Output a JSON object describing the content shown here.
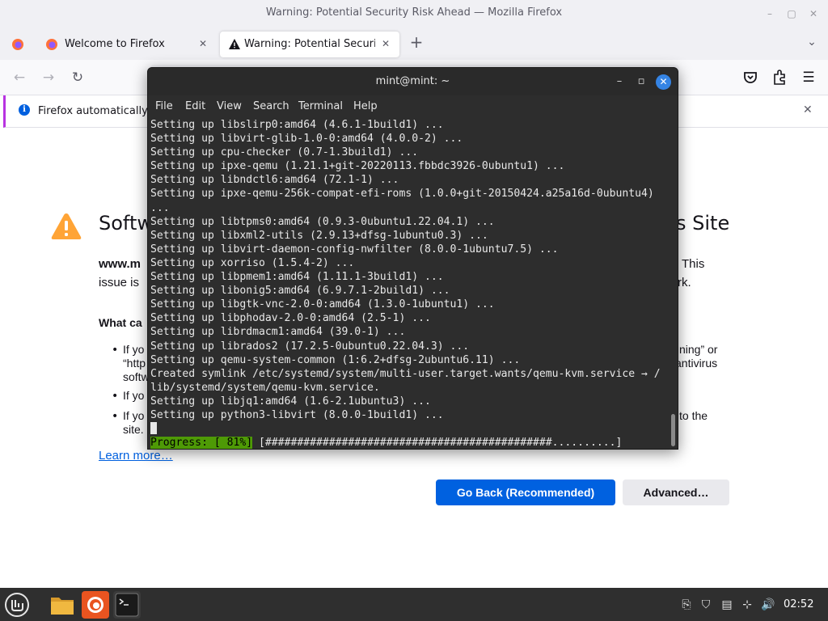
{
  "firefox": {
    "window_title": "Warning: Potential Security Risk Ahead — Mozilla Firefox",
    "tabs": [
      {
        "label": "Welcome to Firefox",
        "active": false
      },
      {
        "label": "Warning: Potential Security Risk Ahead",
        "active": true
      }
    ],
    "notification": {
      "text": "Firefox automatically s"
    },
    "page": {
      "heading_start": "Softw",
      "heading_end": "s Site",
      "para1_line1_start": "www.m",
      "para1_line1_end": "This",
      "para1_line2_start": "issue is",
      "para1_line2_end": "rk.",
      "what_can_heading": "What ca",
      "bullet1_line1_start": "If yo",
      "bullet1_line1_end": "ning” or",
      "bullet1_line2_start": "“http",
      "bullet1_line2_end": "antivirus",
      "bullet1_line3_start": "softw",
      "bullet2_start": "If yo",
      "bullet3_line1_start": "If yo",
      "bullet3_line1_end": "to the",
      "bullet3_line2_start": "site.",
      "learn_more": "Learn more…",
      "go_back_button": "Go Back (Recommended)",
      "advanced_button": "Advanced…"
    }
  },
  "terminal": {
    "title": "mint@mint: ~",
    "menu": [
      "File",
      "Edit",
      "View",
      "Search",
      "Terminal",
      "Help"
    ],
    "lines": [
      "Setting up libslirp0:amd64 (4.6.1-1build1) ...",
      "Setting up libvirt-glib-1.0-0:amd64 (4.0.0-2) ...",
      "Setting up cpu-checker (0.7-1.3build1) ...",
      "Setting up ipxe-qemu (1.21.1+git-20220113.fbbdc3926-0ubuntu1) ...",
      "Setting up libndctl6:amd64 (72.1-1) ...",
      "Setting up ipxe-qemu-256k-compat-efi-roms (1.0.0+git-20150424.a25a16d-0ubuntu4)",
      "...",
      "Setting up libtpms0:amd64 (0.9.3-0ubuntu1.22.04.1) ...",
      "Setting up libxml2-utils (2.9.13+dfsg-1ubuntu0.3) ...",
      "Setting up libvirt-daemon-config-nwfilter (8.0.0-1ubuntu7.5) ...",
      "Setting up xorriso (1.5.4-2) ...",
      "Setting up libpmem1:amd64 (1.11.1-3build1) ...",
      "Setting up libonig5:amd64 (6.9.7.1-2build1) ...",
      "Setting up libgtk-vnc-2.0-0:amd64 (1.3.0-1ubuntu1) ...",
      "Setting up libphodav-2.0-0:amd64 (2.5-1) ...",
      "Setting up librdmacm1:amd64 (39.0-1) ...",
      "Setting up librados2 (17.2.5-0ubuntu0.22.04.3) ...",
      "Setting up qemu-system-common (1:6.2+dfsg-2ubuntu6.11) ...",
      "Created symlink /etc/systemd/system/multi-user.target.wants/qemu-kvm.service → /",
      "lib/systemd/system/qemu-kvm.service.",
      "Setting up libjq1:amd64 (1.6-2.1ubuntu3) ...",
      "Setting up python3-libvirt (8.0.0-1build1) ..."
    ],
    "progress": {
      "label": "Progress: [ 81%]",
      "bar": "[#############################################..........]",
      "percent": 81
    }
  },
  "taskbar": {
    "clock": "02:52",
    "apps": [
      "mint-menu",
      "files",
      "firefox",
      "terminal"
    ]
  },
  "colors": {
    "accent_blue": "#0061e0",
    "terminal_bg": "#2d2d2d",
    "progress_green": "#4e9a06",
    "taskbar_bg": "#2f2f2f"
  }
}
